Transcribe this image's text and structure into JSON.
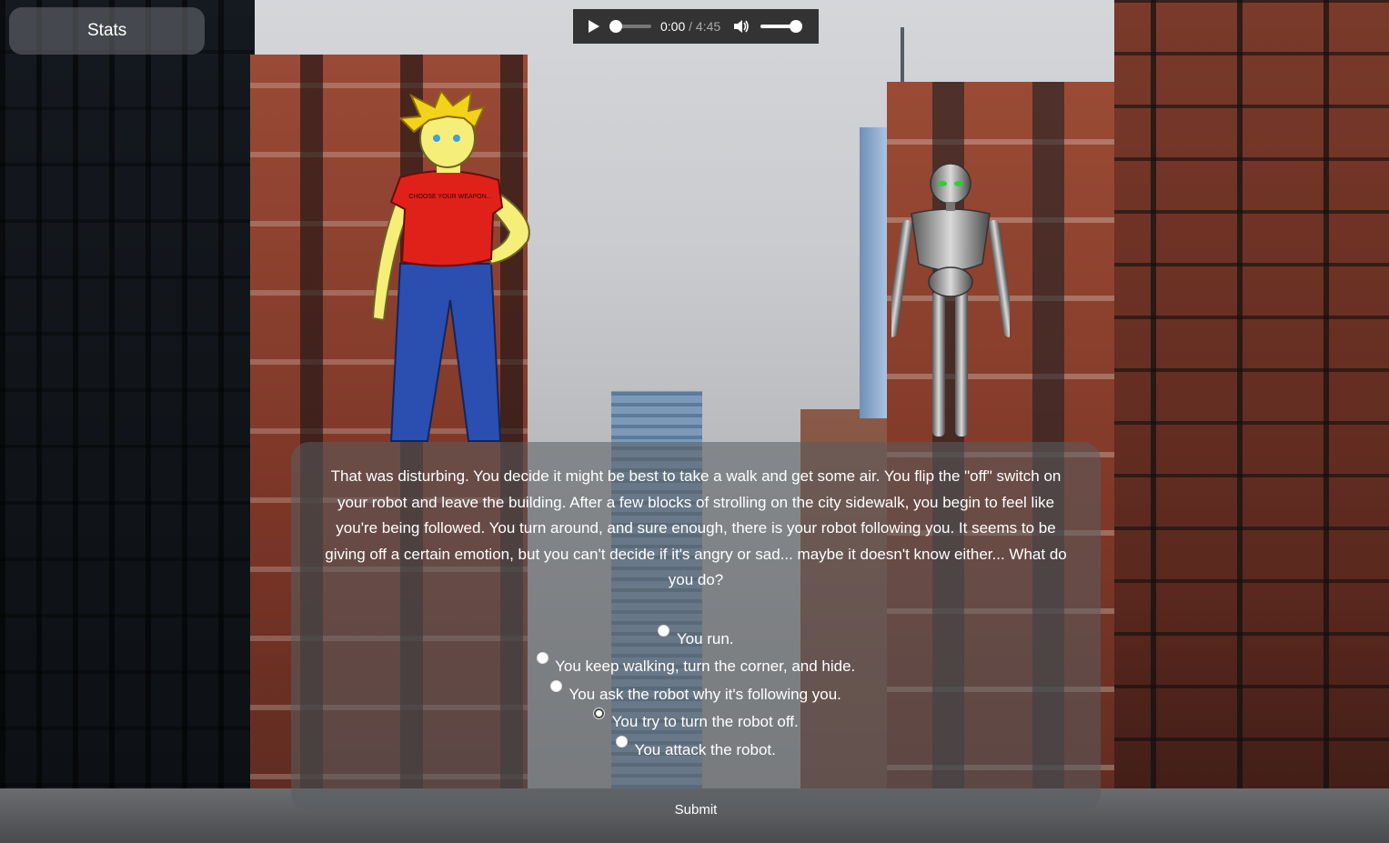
{
  "stats_button": {
    "label": "Stats"
  },
  "audio_player": {
    "current_time": "0:00",
    "separator": " / ",
    "duration": "4:45"
  },
  "story": {
    "text": "That was disturbing. You decide it might be best to take a walk and get some air. You flip the \"off\" switch on your robot and leave the building. After a few blocks of strolling on the city sidewalk, you begin to feel like you're being followed. You turn around, and sure enough, there is your robot following you. It seems to be giving off a certain emotion, but you can't decide if it's angry or sad... maybe it doesn't know either... What do you do?"
  },
  "choices": [
    {
      "label": "You run."
    },
    {
      "label": "You keep walking, turn the corner, and hide."
    },
    {
      "label": "You ask the robot why it's following you."
    },
    {
      "label": "You try to turn the robot off."
    },
    {
      "label": "You attack the robot."
    }
  ],
  "submit_button": {
    "label": "Submit"
  },
  "hero_shirt_text": "CHOOSE YOUR WEAPON...",
  "colors": {
    "panel_bg": "#5a5c60",
    "audio_bg": "#333333",
    "hero_shirt": "#e0211a",
    "hero_hair": "#f3d21a",
    "robot_eyes": "#2bd12b"
  }
}
